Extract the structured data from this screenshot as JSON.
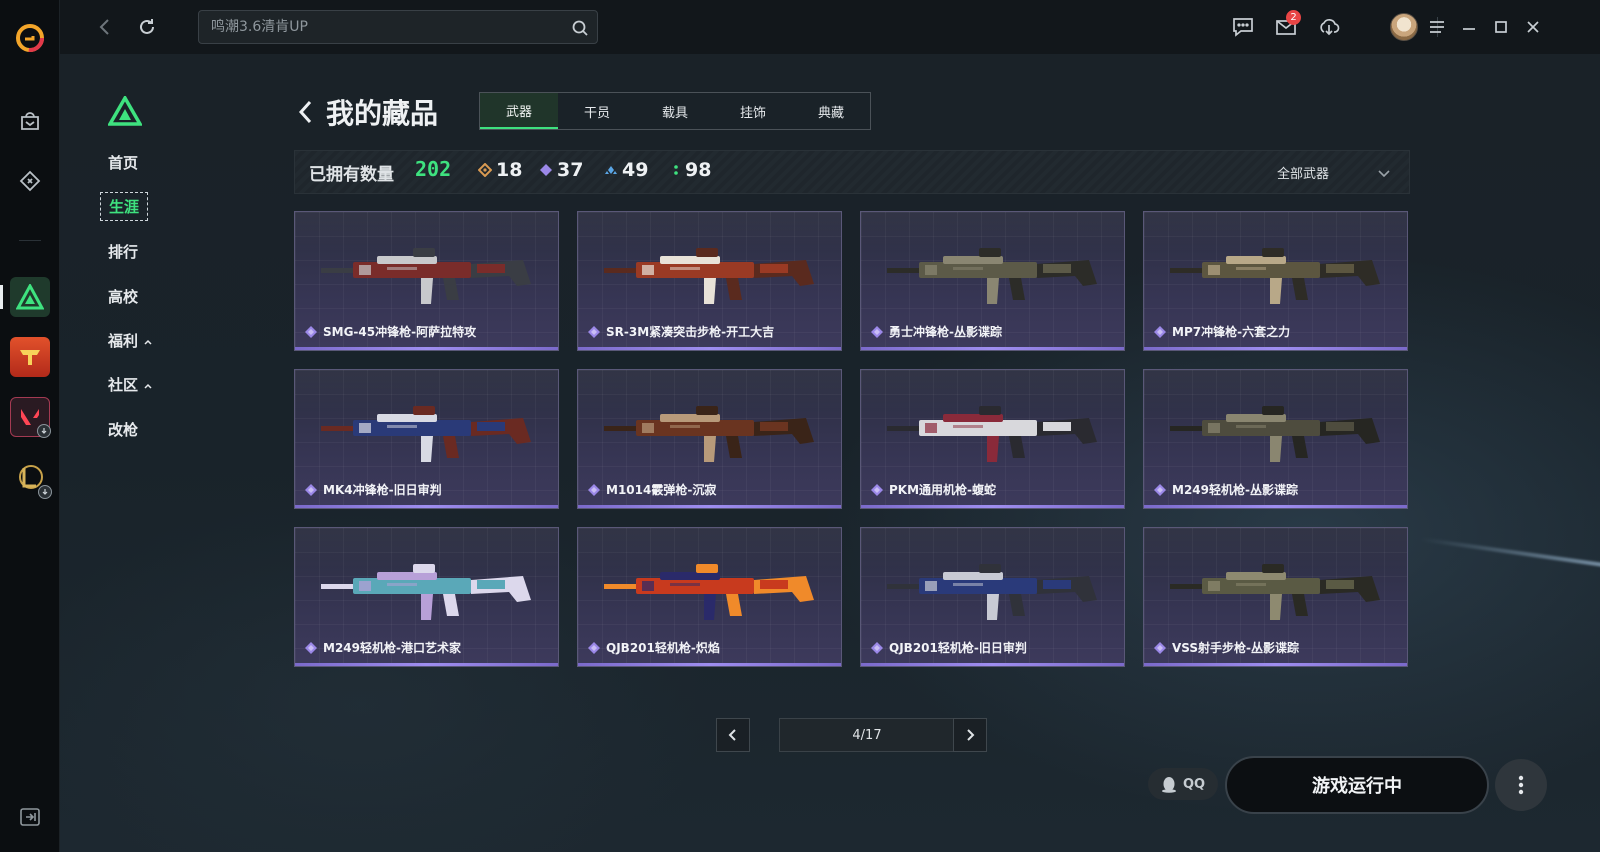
{
  "topbar": {
    "search_placeholder": "鸣潮3.6清肯UP",
    "mail_badge": "2"
  },
  "game_nav": {
    "items": [
      {
        "label": "首页",
        "active": false
      },
      {
        "label": "生涯",
        "active": true
      },
      {
        "label": "排行",
        "active": false
      },
      {
        "label": "高校",
        "active": false
      },
      {
        "label": "福利",
        "active": false,
        "expand": true
      },
      {
        "label": "社区",
        "active": false,
        "expand": true
      },
      {
        "label": "改枪",
        "active": false
      }
    ]
  },
  "header": {
    "title": "我的藏品",
    "tabs": [
      "武器",
      "干员",
      "载具",
      "挂饰",
      "典藏"
    ],
    "active_tab": "武器"
  },
  "stats": {
    "owned_label": "已拥有数量",
    "owned_total": "202",
    "counts": [
      {
        "value": "18",
        "color": "#d99a52"
      },
      {
        "value": "37",
        "color": "#9b88e8"
      },
      {
        "value": "49",
        "color": "#5aa6e6"
      },
      {
        "value": "98",
        "color": "#3ee27f"
      }
    ],
    "filter_label": "全部武器"
  },
  "items": [
    {
      "name": "SMG-45冲锋枪-阿萨拉特攻",
      "palette": [
        "#7a2c2a",
        "#c8c9cc",
        "#3a3d44"
      ]
    },
    {
      "name": "SR-3M紧凑突击步枪-开工大吉",
      "palette": [
        "#9a3a24",
        "#e8e2d8",
        "#5a2a1e"
      ]
    },
    {
      "name": "勇士冲锋枪-丛影谍踪",
      "palette": [
        "#5c5a48",
        "#8a8672",
        "#2c2c28"
      ]
    },
    {
      "name": "MP7冲锋枪-六套之力",
      "palette": [
        "#5c5640",
        "#b8a888",
        "#2e2c26"
      ]
    },
    {
      "name": "MK4冲锋枪-旧日审判",
      "palette": [
        "#2a3a78",
        "#d8dae4",
        "#6a2a22"
      ]
    },
    {
      "name": "M1014霰弹枪-沉寂",
      "palette": [
        "#6a3420",
        "#b89a7a",
        "#3a2418"
      ]
    },
    {
      "name": "PKM通用机枪-蝮蛇",
      "palette": [
        "#d8d8dc",
        "#8a2a3a",
        "#2a2a30"
      ]
    },
    {
      "name": "M249轻机枪-丛影谍踪",
      "palette": [
        "#4e4c3e",
        "#8a8670",
        "#262622"
      ]
    },
    {
      "name": "M249轻机枪-港口艺术家",
      "palette": [
        "#5aa8b8",
        "#b8a0d8",
        "#dcd8ec"
      ]
    },
    {
      "name": "QJB201轻机枪-炽焰",
      "palette": [
        "#c83a1e",
        "#2a2a6a",
        "#f08a2a"
      ]
    },
    {
      "name": "QJB201轻机枪-旧日审判",
      "palette": [
        "#2a3a7a",
        "#c8cad4",
        "#30323a"
      ]
    },
    {
      "name": "VSS射手步枪-丛影谍踪",
      "palette": [
        "#5a5a44",
        "#8e8a70",
        "#2a2a24"
      ]
    }
  ],
  "pagination": {
    "value": "4/17"
  },
  "bottom": {
    "qq_label": "QQ",
    "run_label": "游戏运行中"
  }
}
